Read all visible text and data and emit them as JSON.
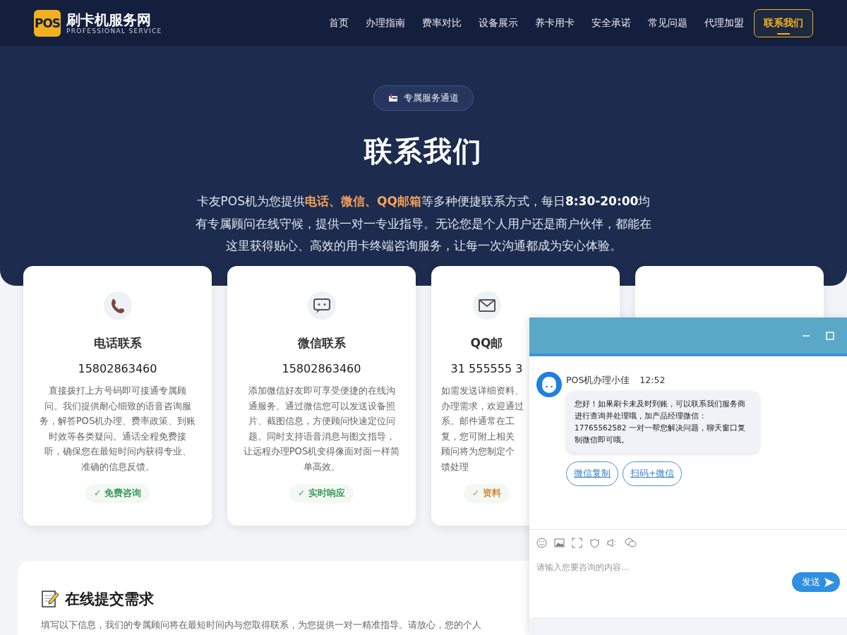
{
  "header": {
    "logo_badge": "POS",
    "logo_title": "刷卡机服务网",
    "logo_subtitle": "PROFESSIONAL SERVICE",
    "nav": [
      {
        "label": "首页",
        "selected": false
      },
      {
        "label": "办理指南",
        "selected": false
      },
      {
        "label": "费率对比",
        "selected": false
      },
      {
        "label": "设备展示",
        "selected": false
      },
      {
        "label": "养卡用卡",
        "selected": false
      },
      {
        "label": "安全承诺",
        "selected": false
      },
      {
        "label": "常见问题",
        "selected": false
      },
      {
        "label": "代理加盟",
        "selected": false
      },
      {
        "label": "联系我们",
        "selected": true
      }
    ]
  },
  "hero": {
    "pill": "专属服务通道",
    "title": "联系我们",
    "description": "卡友POS机为您提供**电话、微信、QQ邮箱**等多种便捷联系方式，每日**8:30-20:00**均有专属顾问在线守候，提供一对一专业指导。无论您是个人用户还是商户伙伴，都能在这里获得贴心、高效的用卡终端咨询服务，让每一次沟通都成为安心体验。"
  },
  "cards": [
    {
      "kind": "phone",
      "title": "电话联系",
      "value": "15802863460",
      "lines": [
        "直接拨打上方号码即可接通专属顾",
        "问。我们提供耐心细致的语音咨询服",
        "务，解答POS机办理、费率政策、到账",
        "时效等各类疑问。通话全程免费接",
        "听，确保您在最短时间内获得专业、",
        "准确的信息反馈。"
      ],
      "badge": "✓ 免费咨询",
      "color": "#3d9a5c"
    },
    {
      "kind": "chat",
      "title": "微信联系",
      "value": "15802863460",
      "lines": [
        "添加微信好友即可享受便捷的在线沟",
        "通服务。通过微信您可以发送设备照",
        "片、截图信息，方便顾问快速定位问",
        "题。同时支持语音消息与图文指导，",
        "让远程办理POS机变得像面对面一样简",
        "单高效。"
      ],
      "badge": "✓ 实时响应",
      "color": "#3d9a5c"
    },
    {
      "kind": "mail",
      "title": "QQ邮",
      "value": "31 555555 3",
      "lines": [
        "如需发送详细资料、",
        "办理需求，欢迎通过",
        "系。邮件通常在工",
        "复，您可附上相关",
        "顾问将为您制定个",
        "馈处理"
      ],
      "badge": "✓ 资料",
      "color": "#d08a3a"
    },
    {
      "kind": "covered"
    }
  ],
  "form": {
    "title": "在线提交需求",
    "description": "填写以下信息，我们的专属顾问将在最短时间内与您取得联系，为您提供一对一精准指导。请放心，您的个人"
  },
  "chat": {
    "agent": "POS机办理小佳",
    "time": "12:52",
    "message": "您好！如果刷卡未及时到账，可以联系我们服务商进行查询并处理哦，加产品经理微信：17765562582 一对一帮您解决问题，聊天窗口复制微信即可哦。",
    "actions": [
      "微信复制",
      "扫码+微信"
    ],
    "input": {
      "placeholder": "请输入您要咨询的内容..."
    },
    "send": "发送"
  }
}
